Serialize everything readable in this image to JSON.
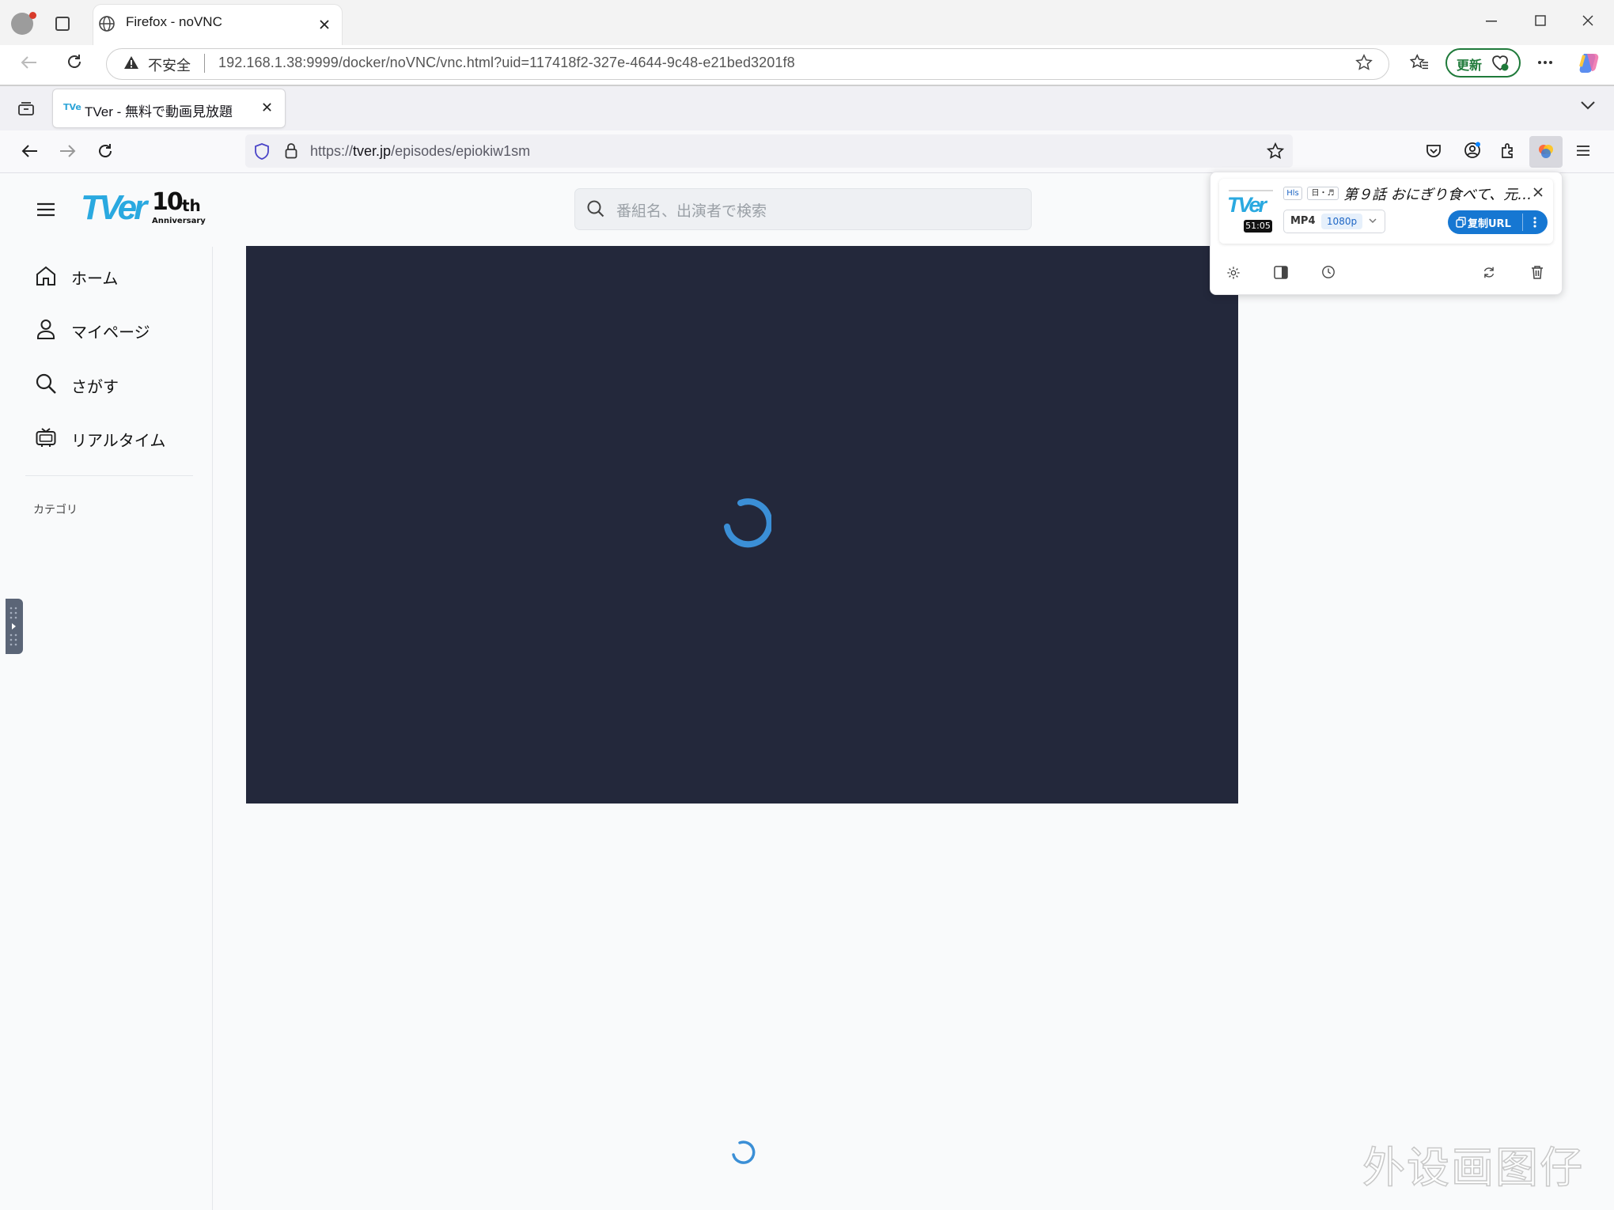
{
  "edge": {
    "tab_title": "Firefox - noVNC",
    "security_label": "不安全",
    "url": "192.168.1.38:9999/docker/noVNC/vnc.html?uid=117418f2-327e-4644-9c48-e21bed3201f8",
    "update_label": "更新"
  },
  "firefox": {
    "tab_title": "TVer - 無料で動画見放題",
    "url_prefix": "https://",
    "url_host": "tver.jp",
    "url_path": "/episodes/epiokiw1sm"
  },
  "page": {
    "logo_brand": "TVer",
    "logo_anniv_number": "10",
    "logo_anniv_suffix": "th",
    "logo_anniv_word": "Anniversary",
    "search_placeholder": "番組名、出演者で検索",
    "nav": [
      {
        "label": "ホーム",
        "icon": "home-icon"
      },
      {
        "label": "マイページ",
        "icon": "user-icon"
      },
      {
        "label": "さがす",
        "icon": "search-icon"
      },
      {
        "label": "リアルタイム",
        "icon": "tv-icon"
      }
    ],
    "category_label": "カテゴリ"
  },
  "popup": {
    "thumb_brand": "TVer",
    "duration": "51:05",
    "stream_type": "Hls",
    "lang_chip": "日・♬",
    "title": "第９話 おにぎり食べて、元…",
    "format": "MP4",
    "resolution": "1080p",
    "copy_label": "复制URL"
  },
  "watermark": "外设画图仔",
  "colors": {
    "player_bg": "#23283b",
    "spinner": "#3b8fd6",
    "brand_blue": "#1677d2",
    "update_green": "#1f7a3a"
  }
}
